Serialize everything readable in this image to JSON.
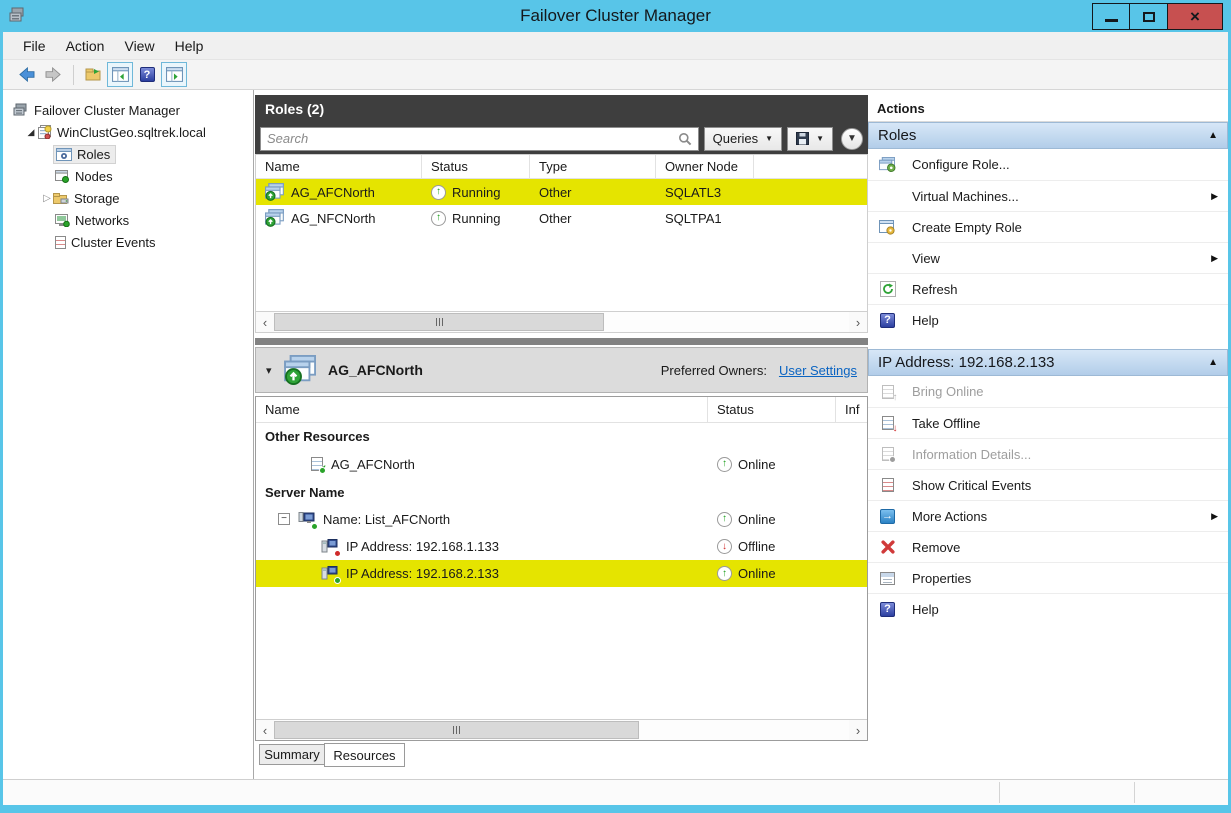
{
  "window": {
    "title": "Failover Cluster Manager"
  },
  "menu": {
    "items": [
      "File",
      "Action",
      "View",
      "Help"
    ]
  },
  "tree": {
    "root": "Failover Cluster Manager",
    "cluster": "WinClustGeo.sqltrek.local",
    "items": [
      "Roles",
      "Nodes",
      "Storage",
      "Networks",
      "Cluster Events"
    ]
  },
  "roles": {
    "header": "Roles (2)",
    "search_placeholder": "Search",
    "queries_label": "Queries",
    "columns": [
      "Name",
      "Status",
      "Type",
      "Owner Node"
    ],
    "rows": [
      {
        "name": "AG_AFCNorth",
        "status": "Running",
        "type": "Other",
        "owner_node": "SQLATL3"
      },
      {
        "name": "AG_NFCNorth",
        "status": "Running",
        "type": "Other",
        "owner_node": "SQLTPA1"
      }
    ]
  },
  "detail": {
    "title": "AG_AFCNorth",
    "preferred_owners_label": "Preferred Owners:",
    "preferred_owners_link": "User Settings",
    "columns": [
      "Name",
      "Status",
      "Inf"
    ],
    "group_other": "Other Resources",
    "group_server": "Server Name",
    "rows": [
      {
        "name": "AG_AFCNorth",
        "status": "Online"
      },
      {
        "name": "Name: List_AFCNorth",
        "status": "Online"
      },
      {
        "name": "IP Address: 192.168.1.133",
        "status": "Offline"
      },
      {
        "name": "IP Address: 192.168.2.133",
        "status": "Online"
      }
    ]
  },
  "tabs": {
    "summary": "Summary",
    "resources": "Resources"
  },
  "actions": {
    "title": "Actions",
    "sections": [
      {
        "title": "Roles",
        "items": [
          {
            "label": "Configure Role..."
          },
          {
            "label": "Virtual Machines..."
          },
          {
            "label": "Create Empty Role"
          },
          {
            "label": "View"
          },
          {
            "label": "Refresh"
          },
          {
            "label": "Help"
          }
        ]
      },
      {
        "title": "IP Address: 192.168.2.133",
        "items": [
          {
            "label": "Bring Online"
          },
          {
            "label": "Take Offline"
          },
          {
            "label": "Information Details..."
          },
          {
            "label": "Show Critical Events"
          },
          {
            "label": "More Actions"
          },
          {
            "label": "Remove"
          },
          {
            "label": "Properties"
          },
          {
            "label": "Help"
          }
        ]
      }
    ]
  },
  "icons": {
    "submenu_arrow": "▶",
    "collapse_arrow": "▲",
    "detail_chevron": "▾",
    "dropdown_arrow": "▼",
    "scroll_left": "‹",
    "scroll_right": "›",
    "tree_expanded": "◢",
    "tree_collapsed": "▷",
    "expand_minus": "−",
    "status_up": "↑",
    "status_down": "↓",
    "help_glyph": "?",
    "close_glyph": "×",
    "more_actions_glyph": "→",
    "check_glyph": "✓"
  },
  "colors": {
    "titlebar": "#58c5e8",
    "close_button": "#c75050",
    "highlight_row": "#e5e400",
    "dark_header": "#3e3e3e",
    "section_header_top": "#d7e7f7",
    "section_header_bottom": "#b2cde9",
    "link": "#0a64c2"
  }
}
